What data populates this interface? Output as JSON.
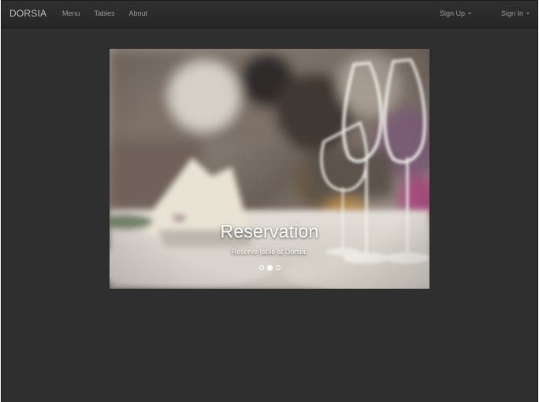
{
  "navbar": {
    "brand": "DORSIA",
    "links": [
      "Menu",
      "Tables",
      "About"
    ],
    "sign_up": "Sign Up",
    "sign_in": "Sign In"
  },
  "carousel": {
    "title": "Reservation",
    "subtitle": "Reserve table at Dorsia.",
    "indicators": [
      {
        "active": false
      },
      {
        "active": true
      },
      {
        "active": false
      }
    ]
  }
}
